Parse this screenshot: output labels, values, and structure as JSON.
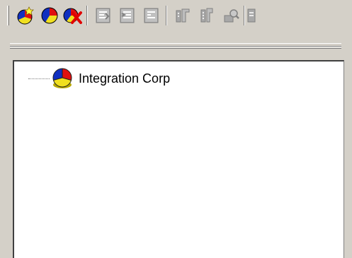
{
  "toolbar": {
    "buttons": [
      {
        "icon": "add-pie-icon",
        "enabled": true
      },
      {
        "icon": "pie-properties-icon",
        "enabled": true
      },
      {
        "icon": "delete-pie-icon",
        "enabled": true
      },
      {
        "icon": "document-icon-1",
        "enabled": false
      },
      {
        "icon": "document-icon-2",
        "enabled": false
      },
      {
        "icon": "document-icon-3",
        "enabled": false
      },
      {
        "icon": "tool-icon-1",
        "enabled": false
      },
      {
        "icon": "tool-icon-2",
        "enabled": false
      },
      {
        "icon": "search-tool-icon",
        "enabled": false
      }
    ]
  },
  "tree": {
    "nodes": [
      {
        "label": "Integration Corp",
        "icon": "organization-pie-icon"
      }
    ]
  },
  "colors": {
    "face": "#d4d0c8",
    "tree_background": "#ffffff",
    "pie_red": "#e01010",
    "pie_blue": "#1030c0",
    "pie_yellow": "#f0e020"
  }
}
